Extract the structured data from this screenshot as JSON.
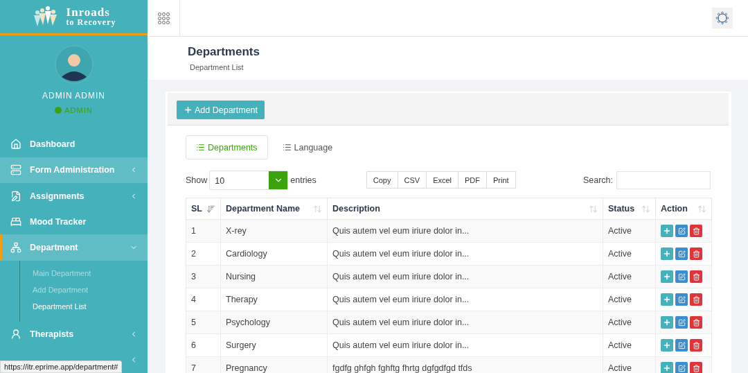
{
  "logo": {
    "title": "Inroads",
    "subtitle": "to Recovery"
  },
  "profile": {
    "name": "ADMIN ADMIN",
    "role": "ADMIN",
    "online": true
  },
  "sidebar": {
    "items": [
      {
        "label": "Dashboard",
        "expandable": false,
        "selected": false,
        "highlighted": false
      },
      {
        "label": "Form Administration",
        "expandable": true,
        "expanded": false,
        "selected": false,
        "highlighted": true
      },
      {
        "label": "Assignments",
        "expandable": true,
        "expanded": false,
        "selected": false,
        "highlighted": false
      },
      {
        "label": "Mood Tracker",
        "expandable": false,
        "selected": false,
        "highlighted": false
      },
      {
        "label": "Department",
        "expandable": true,
        "expanded": true,
        "selected": true,
        "highlighted": true,
        "children": [
          {
            "label": "Main Department",
            "selected": false
          },
          {
            "label": "Add Department",
            "selected": false
          },
          {
            "label": "Department List",
            "selected": true
          }
        ]
      },
      {
        "label": "Therapists",
        "expandable": true,
        "expanded": false,
        "selected": false,
        "highlighted": false
      },
      {
        "expandable": true,
        "expanded": false
      }
    ]
  },
  "page": {
    "title": "Departments",
    "subtitle": "Department List"
  },
  "add_button": "Add Department",
  "tabs": [
    {
      "label": "Departments",
      "selected": true
    },
    {
      "label": "Language",
      "selected": false
    }
  ],
  "length": {
    "before": "Show",
    "value": "10",
    "after": "entries"
  },
  "export_buttons": [
    "Copy",
    "CSV",
    "Excel",
    "PDF",
    "Print"
  ],
  "search": {
    "label": "Search:"
  },
  "table": {
    "columns": [
      {
        "label": "SL",
        "sorted": true
      },
      {
        "label": "Department Name",
        "sorted": false
      },
      {
        "label": "Description",
        "sorted": false
      },
      {
        "label": "Status",
        "sorted": false
      },
      {
        "label": "Action",
        "sorted": false
      }
    ],
    "rows": [
      {
        "sl": "1",
        "name": "X-rey",
        "description": "Quis autem vel eum iriure dolor in...",
        "status": "Active"
      },
      {
        "sl": "2",
        "name": "Cardiology",
        "description": "Quis autem vel eum iriure dolor in...",
        "status": "Active"
      },
      {
        "sl": "3",
        "name": "Nursing",
        "description": "Quis autem vel eum iriure dolor in...",
        "status": "Active"
      },
      {
        "sl": "4",
        "name": "Therapy",
        "description": "Quis autem vel eum iriure dolor in...",
        "status": "Active"
      },
      {
        "sl": "5",
        "name": "Psychology",
        "description": "Quis autem vel eum iriure dolor in...",
        "status": "Active"
      },
      {
        "sl": "6",
        "name": "Surgery",
        "description": "Quis autem vel eum iriure dolor in...",
        "status": "Active"
      },
      {
        "sl": "7",
        "name": "Pregnancy",
        "description": "fgdfg ghfgh fghftg fhrtg dgfgdfgd tfds",
        "status": "Active"
      }
    ]
  },
  "status_bar": "https://itr.eprime.app/department#"
}
